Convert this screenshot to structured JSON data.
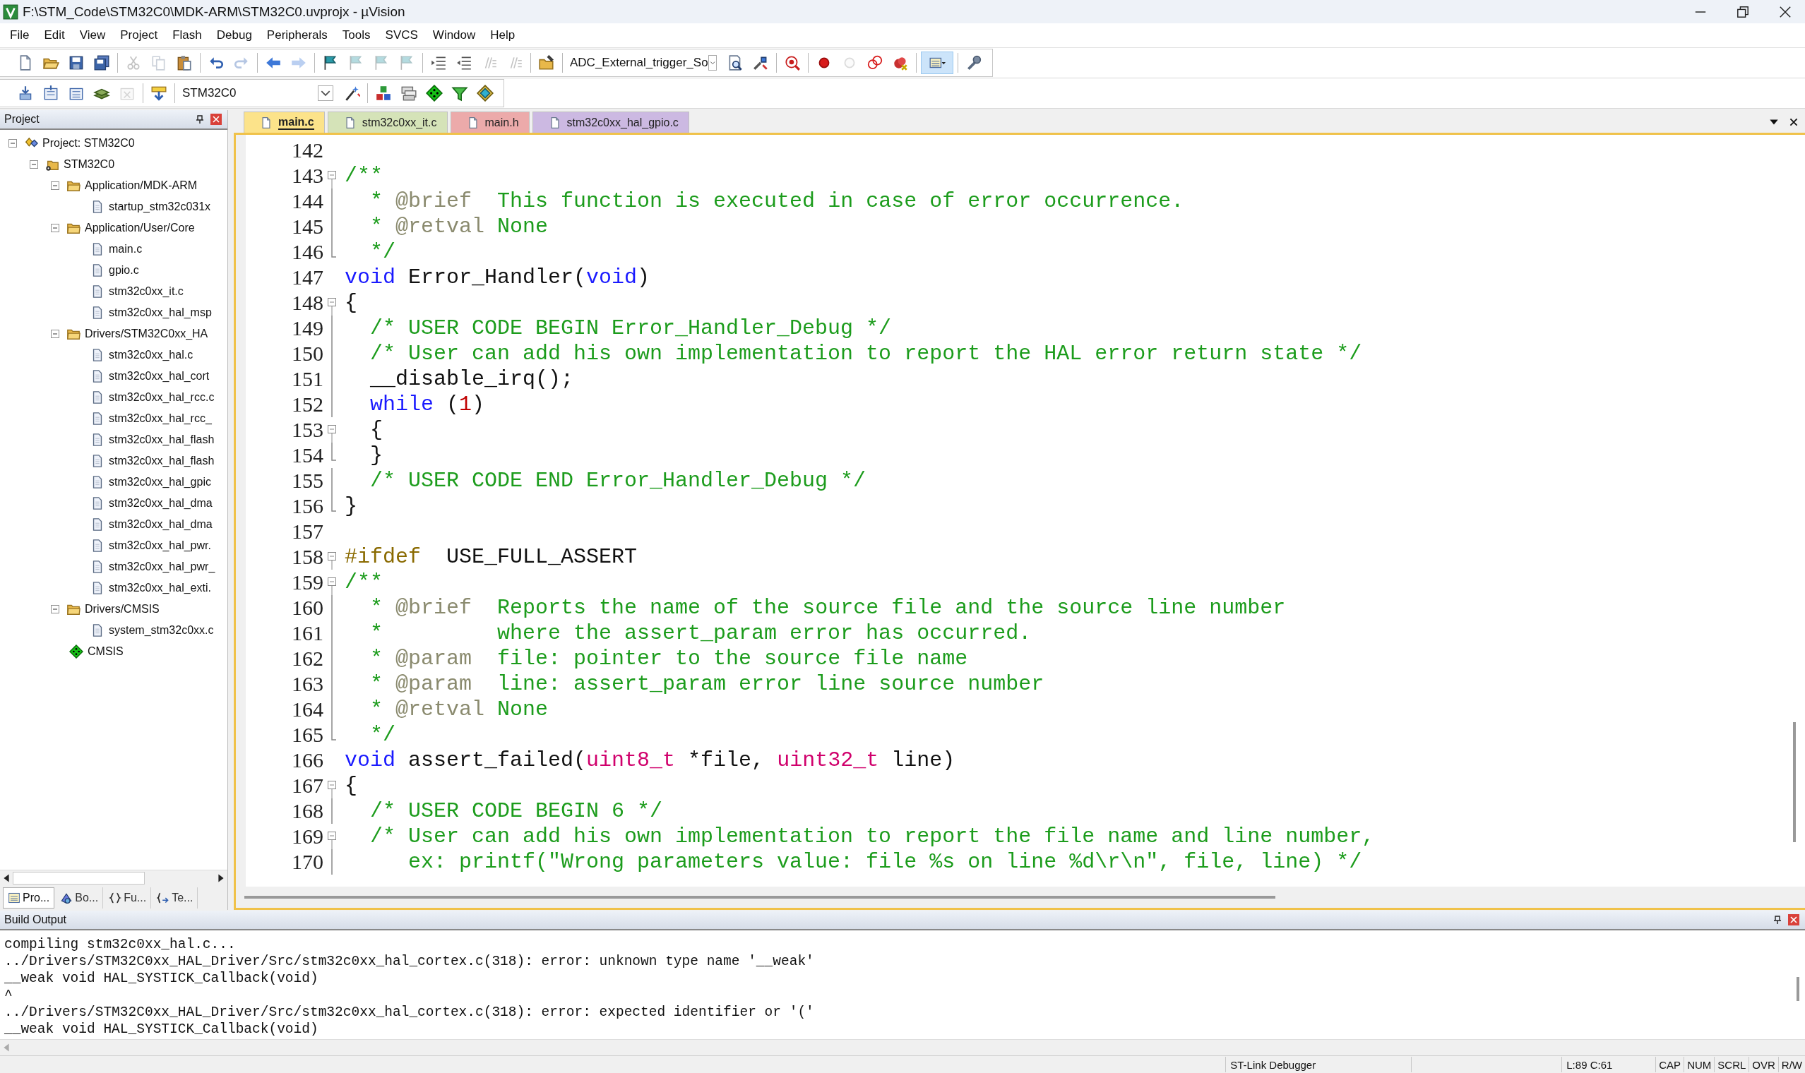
{
  "window": {
    "title": "F:\\STM_Code\\STM32C0\\MDK-ARM\\STM32C0.uvprojx - µVision"
  },
  "menu": [
    "File",
    "Edit",
    "View",
    "Project",
    "Flash",
    "Debug",
    "Peripherals",
    "Tools",
    "SVCS",
    "Window",
    "Help"
  ],
  "toolbar_1": {
    "buttons_left": [
      {
        "disabled": false
      },
      {
        "disabled": false
      },
      {
        "disabled": false
      },
      {
        "disabled": false
      },
      {
        "disabled": true
      },
      {
        "disabled": true
      },
      {
        "disabled": false
      },
      {
        "disabled": false
      },
      {
        "disabled": true
      },
      {
        "disabled": false
      },
      {
        "disabled": true
      },
      {
        "disabled": false
      },
      {
        "disabled": true
      },
      {
        "disabled": true
      },
      {
        "disabled": true
      },
      {
        "disabled": false
      },
      {
        "disabled": false
      },
      {
        "disabled": true
      },
      {
        "disabled": true
      },
      {
        "disabled": false
      }
    ],
    "dropdown": {
      "value": "ADC_External_trigger_So"
    },
    "buttons_right": [
      {
        "disabled": false,
        "on": false
      },
      {
        "disabled": false,
        "on": false
      },
      {
        "disabled": false,
        "on": false
      },
      {
        "disabled": false,
        "on": false
      },
      {
        "disabled": true,
        "on": false
      },
      {
        "disabled": false,
        "on": false
      },
      {
        "disabled": false,
        "on": false
      },
      {
        "disabled": false,
        "on": true
      },
      {
        "disabled": false,
        "on": false
      }
    ]
  },
  "toolbar_2": {
    "buttons_left": [
      {
        "disabled": false
      },
      {
        "disabled": false
      },
      {
        "disabled": false
      },
      {
        "disabled": false
      },
      {
        "disabled": true
      },
      {
        "disabled": false
      }
    ],
    "dropdown": {
      "value": "STM32C0"
    },
    "buttons_right": [
      {
        "disabled": false
      },
      {
        "disabled": false
      },
      {
        "disabled": false
      },
      {
        "disabled": false
      },
      {
        "disabled": false
      },
      {
        "disabled": false
      }
    ]
  },
  "project_panel": {
    "title": "Project",
    "tree": [
      {
        "kind": "project",
        "label": "Project: STM32C0",
        "expanded": true,
        "children": [
          {
            "kind": "target",
            "label": "STM32C0",
            "expanded": true,
            "children": [
              {
                "kind": "group",
                "label": "Application/MDK-ARM",
                "expanded": true,
                "children": [
                  {
                    "kind": "file",
                    "label": "startup_stm32c031x"
                  }
                ]
              },
              {
                "kind": "group",
                "label": "Application/User/Core",
                "expanded": true,
                "children": [
                  {
                    "kind": "file",
                    "label": "main.c"
                  },
                  {
                    "kind": "file",
                    "label": "gpio.c"
                  },
                  {
                    "kind": "file",
                    "label": "stm32c0xx_it.c"
                  },
                  {
                    "kind": "file",
                    "label": "stm32c0xx_hal_msp"
                  }
                ]
              },
              {
                "kind": "group",
                "label": "Drivers/STM32C0xx_HA",
                "expanded": true,
                "children": [
                  {
                    "kind": "file",
                    "label": "stm32c0xx_hal.c"
                  },
                  {
                    "kind": "file",
                    "label": "stm32c0xx_hal_cort"
                  },
                  {
                    "kind": "file",
                    "label": "stm32c0xx_hal_rcc.c"
                  },
                  {
                    "kind": "file",
                    "label": "stm32c0xx_hal_rcc_"
                  },
                  {
                    "kind": "file",
                    "label": "stm32c0xx_hal_flash"
                  },
                  {
                    "kind": "file",
                    "label": "stm32c0xx_hal_flash"
                  },
                  {
                    "kind": "file",
                    "label": "stm32c0xx_hal_gpic"
                  },
                  {
                    "kind": "file",
                    "label": "stm32c0xx_hal_dma"
                  },
                  {
                    "kind": "file",
                    "label": "stm32c0xx_hal_dma"
                  },
                  {
                    "kind": "file",
                    "label": "stm32c0xx_hal_pwr."
                  },
                  {
                    "kind": "file",
                    "label": "stm32c0xx_hal_pwr_"
                  },
                  {
                    "kind": "file",
                    "label": "stm32c0xx_hal_exti."
                  }
                ]
              },
              {
                "kind": "group",
                "label": "Drivers/CMSIS",
                "expanded": true,
                "children": [
                  {
                    "kind": "file",
                    "label": "system_stm32c0xx.c"
                  }
                ]
              },
              {
                "kind": "component",
                "label": "CMSIS"
              }
            ]
          }
        ]
      }
    ],
    "tabs": [
      {
        "label": "Pro...",
        "selected": true
      },
      {
        "label": "Bo...",
        "selected": false
      },
      {
        "label": "Fu...",
        "selected": false
      },
      {
        "label": "Te...",
        "selected": false
      }
    ]
  },
  "editor": {
    "tabs": [
      {
        "label": "main.c",
        "selected": true,
        "color": "#fce38a"
      },
      {
        "label": "stm32c0xx_it.c",
        "selected": false,
        "color": "#d4e4b4"
      },
      {
        "label": "main.h",
        "selected": false,
        "color": "#f2a8a8"
      },
      {
        "label": "stm32c0xx_hal_gpio.c",
        "selected": false,
        "color": "#cdb8e6"
      }
    ],
    "lines": [
      {
        "number": "142",
        "kind": "plain"
      },
      {
        "number": "143",
        "kind": "fold_start",
        "tokens": [
          {
            "kind": "comment",
            "text": "/**"
          }
        ]
      },
      {
        "number": "144",
        "kind": "fold_line",
        "tokens": [
          {
            "kind": "comment",
            "text": "  * "
          },
          {
            "kind": "doc",
            "text": "@brief"
          },
          {
            "kind": "comment",
            "text": "  This function is executed in case of error occurrence."
          }
        ]
      },
      {
        "number": "145",
        "kind": "fold_line",
        "tokens": [
          {
            "kind": "comment",
            "text": "  * "
          },
          {
            "kind": "doc",
            "text": "@retval"
          },
          {
            "kind": "comment",
            "text": " None"
          }
        ]
      },
      {
        "number": "146",
        "kind": "fold_end",
        "tokens": [
          {
            "kind": "comment",
            "text": "  */"
          }
        ]
      },
      {
        "number": "147",
        "kind": "plain",
        "tokens": [
          {
            "kind": "keyword",
            "text": "void"
          },
          {
            "kind": "plain",
            "text": " Error_Handler("
          },
          {
            "kind": "keyword",
            "text": "void"
          },
          {
            "kind": "plain",
            "text": ")"
          }
        ]
      },
      {
        "number": "148",
        "kind": "fold_start",
        "tokens": [
          {
            "kind": "plain",
            "text": "{"
          }
        ]
      },
      {
        "number": "149",
        "kind": "fold_line",
        "tokens": [
          {
            "kind": "comment",
            "text": "  /* USER CODE BEGIN Error_Handler_Debug */"
          }
        ]
      },
      {
        "number": "150",
        "kind": "fold_line",
        "tokens": [
          {
            "kind": "comment",
            "text": "  /* User can add his own implementation to report the HAL error return state */"
          }
        ]
      },
      {
        "number": "151",
        "kind": "fold_line",
        "tokens": [
          {
            "kind": "plain",
            "text": "  __disable_irq();"
          }
        ]
      },
      {
        "number": "152",
        "kind": "fold_line",
        "tokens": [
          {
            "kind": "keyword",
            "text": "  while"
          },
          {
            "kind": "plain",
            "text": " ("
          },
          {
            "kind": "number",
            "text": "1"
          },
          {
            "kind": "plain",
            "text": ")"
          }
        ]
      },
      {
        "number": "153",
        "kind": "fold_start",
        "tokens": [
          {
            "kind": "plain",
            "text": "  {"
          }
        ]
      },
      {
        "number": "154",
        "kind": "fold_end",
        "tokens": [
          {
            "kind": "plain",
            "text": "  }"
          }
        ]
      },
      {
        "number": "155",
        "kind": "fold_line",
        "tokens": [
          {
            "kind": "comment",
            "text": "  /* USER CODE END Error_Handler_Debug */"
          }
        ]
      },
      {
        "number": "156",
        "kind": "fold_end",
        "tokens": [
          {
            "kind": "plain",
            "text": "}"
          }
        ]
      },
      {
        "number": "157",
        "kind": "plain"
      },
      {
        "number": "158",
        "kind": "fold_start",
        "tokens": [
          {
            "kind": "preproc",
            "text": "#ifdef"
          },
          {
            "kind": "plain",
            "text": "  USE_FULL_ASSERT"
          }
        ]
      },
      {
        "number": "159",
        "kind": "fold_start",
        "tokens": [
          {
            "kind": "comment",
            "text": "/**"
          }
        ]
      },
      {
        "number": "160",
        "kind": "fold_line",
        "tokens": [
          {
            "kind": "comment",
            "text": "  * "
          },
          {
            "kind": "doc",
            "text": "@brief"
          },
          {
            "kind": "comment",
            "text": "  Reports the name of the source file and the source line number"
          }
        ]
      },
      {
        "number": "161",
        "kind": "fold_line",
        "tokens": [
          {
            "kind": "comment",
            "text": "  *         where the assert_param error has occurred."
          }
        ]
      },
      {
        "number": "162",
        "kind": "fold_line",
        "tokens": [
          {
            "kind": "comment",
            "text": "  * "
          },
          {
            "kind": "doc",
            "text": "@param"
          },
          {
            "kind": "comment",
            "text": "  file: pointer to the source file name"
          }
        ]
      },
      {
        "number": "163",
        "kind": "fold_line",
        "tokens": [
          {
            "kind": "comment",
            "text": "  * "
          },
          {
            "kind": "doc",
            "text": "@param"
          },
          {
            "kind": "comment",
            "text": "  line: assert_param error line source number"
          }
        ]
      },
      {
        "number": "164",
        "kind": "fold_line",
        "tokens": [
          {
            "kind": "comment",
            "text": "  * "
          },
          {
            "kind": "doc",
            "text": "@retval"
          },
          {
            "kind": "comment",
            "text": " None"
          }
        ]
      },
      {
        "number": "165",
        "kind": "fold_end",
        "tokens": [
          {
            "kind": "comment",
            "text": "  */"
          }
        ]
      },
      {
        "number": "166",
        "kind": "plain",
        "tokens": [
          {
            "kind": "keyword",
            "text": "void"
          },
          {
            "kind": "plain",
            "text": " assert_failed("
          },
          {
            "kind": "type",
            "text": "uint8_t"
          },
          {
            "kind": "plain",
            "text": " *file, "
          },
          {
            "kind": "type",
            "text": "uint32_t"
          },
          {
            "kind": "plain",
            "text": " line)"
          }
        ]
      },
      {
        "number": "167",
        "kind": "fold_start",
        "tokens": [
          {
            "kind": "plain",
            "text": "{"
          }
        ]
      },
      {
        "number": "168",
        "kind": "fold_line",
        "tokens": [
          {
            "kind": "comment",
            "text": "  /* USER CODE BEGIN 6 */"
          }
        ]
      },
      {
        "number": "169",
        "kind": "fold_start",
        "tokens": [
          {
            "kind": "comment",
            "text": "  /* User can add his own implementation to report the file name and line number,"
          }
        ]
      },
      {
        "number": "170",
        "kind": "fold_line",
        "tokens": [
          {
            "kind": "comment",
            "text": "     ex: printf(\"Wrong parameters value: file %s on line %d\\r\\n\", file, line) */"
          }
        ]
      }
    ]
  },
  "build_output": {
    "title": "Build Output",
    "lines": [
      "compiling stm32c0xx_hal.c...",
      "../Drivers/STM32C0xx_HAL_Driver/Src/stm32c0xx_hal_cortex.c(318): error: unknown type name '__weak'",
      "__weak void HAL_SYSTICK_Callback(void)",
      "^",
      "../Drivers/STM32C0xx_HAL_Driver/Src/stm32c0xx_hal_cortex.c(318): error: expected identifier or '('",
      "__weak void HAL_SYSTICK_Callback(void)"
    ]
  },
  "status_bar": {
    "debugger": "ST-Link Debugger",
    "position": "L:89 C:61",
    "indicators": [
      "CAP",
      "NUM",
      "SCRL",
      "OVR",
      "R/W"
    ]
  }
}
